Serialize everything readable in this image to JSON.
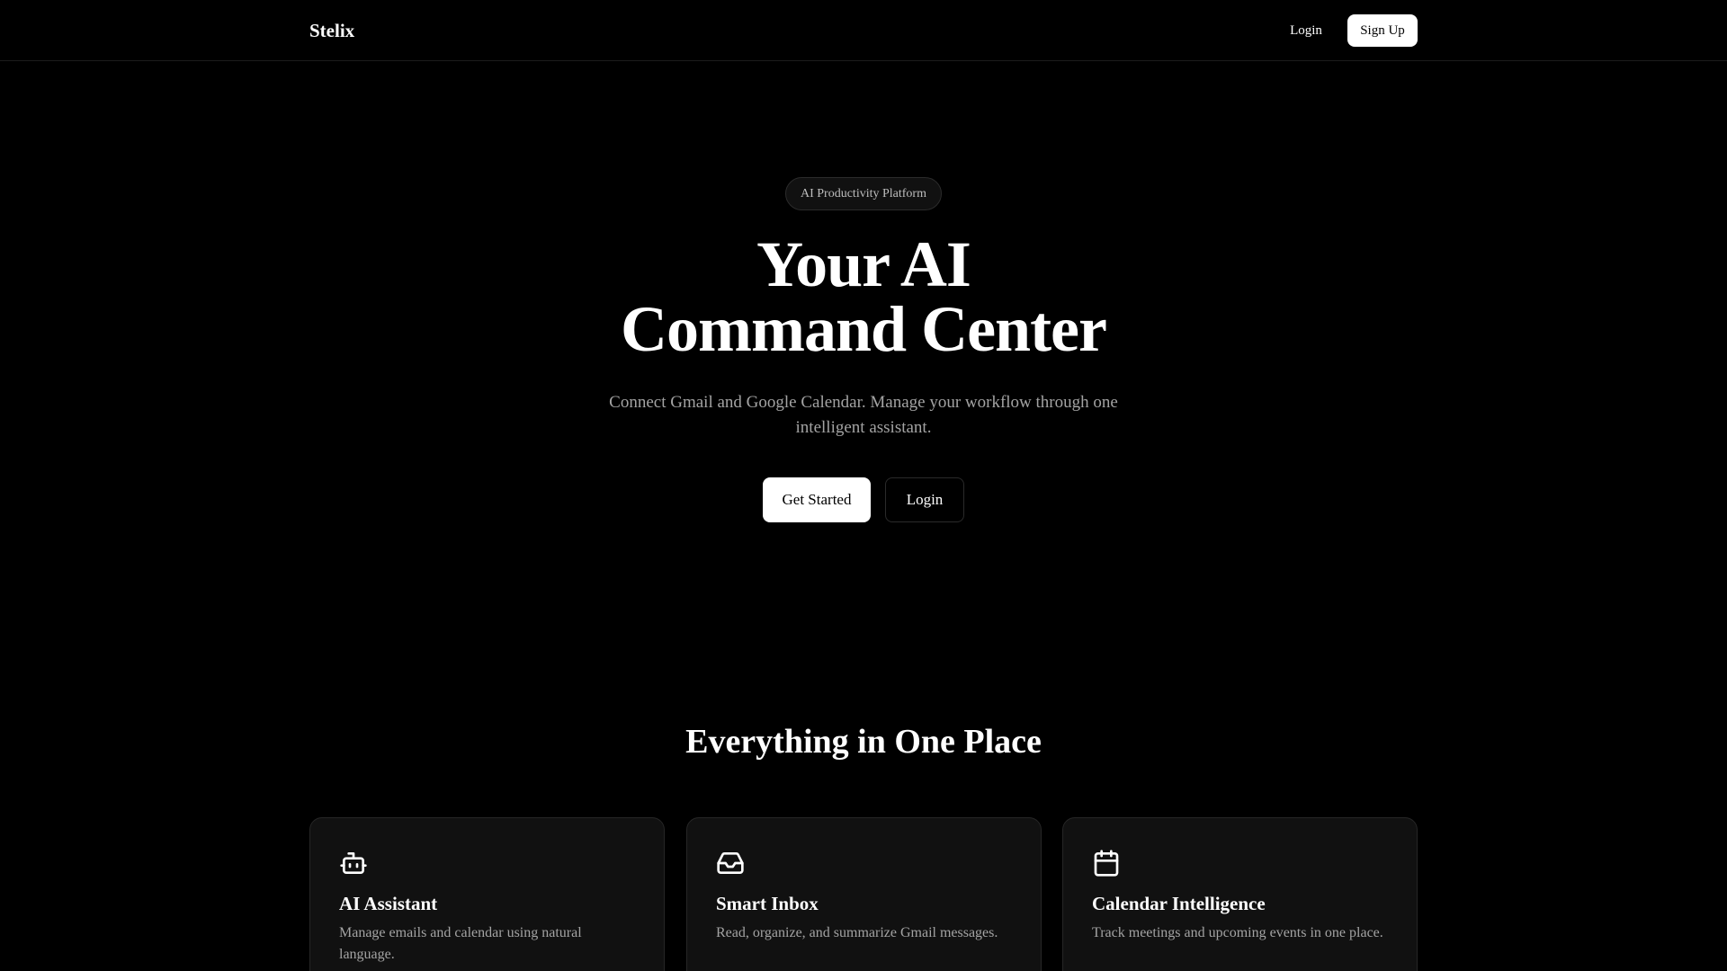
{
  "header": {
    "brand": "Stelix",
    "login_label": "Login",
    "signup_label": "Sign Up"
  },
  "hero": {
    "badge": "AI Productivity Platform",
    "title_line1": "Your AI",
    "title_line2": "Command Center",
    "subtitle": "Connect Gmail and Google Calendar. Manage your workflow through one intelligent assistant.",
    "primary_cta": "Get Started",
    "secondary_cta": "Login"
  },
  "features": {
    "title": "Everything in One Place",
    "cards": [
      {
        "icon": "bot-icon",
        "title": "AI Assistant",
        "description": "Manage emails and calendar using natural language."
      },
      {
        "icon": "inbox-icon",
        "title": "Smart Inbox",
        "description": "Read, organize, and summarize Gmail messages."
      },
      {
        "icon": "calendar-icon",
        "title": "Calendar Intelligence",
        "description": "Track meetings and upcoming events in one place."
      }
    ]
  },
  "colors": {
    "background": "#000000",
    "card_background": "#111111",
    "border": "#262626",
    "text_primary": "#ffffff",
    "text_muted": "#a3a3a3"
  }
}
